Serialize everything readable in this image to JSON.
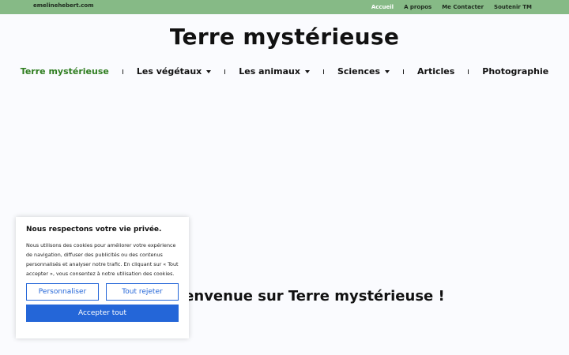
{
  "topbar": {
    "site": "emelinehebert.com",
    "links": [
      "Accueil",
      "A propos",
      "Me Contacter",
      "Soutenir TM"
    ]
  },
  "site_title": "Terre mystérieuse",
  "nav": {
    "items": [
      {
        "label": "Terre mystérieuse",
        "active": true
      },
      {
        "label": "Les végétaux",
        "dropdown": true
      },
      {
        "label": "Les animaux",
        "dropdown": true
      },
      {
        "label": "Sciences",
        "dropdown": true
      },
      {
        "label": "Articles"
      },
      {
        "label": "Photographie"
      }
    ]
  },
  "hero": {
    "title": "Bienvenue sur Terre mystérieuse !",
    "subtitle": ""
  },
  "cookie": {
    "title": "Nous respectons votre vie privée.",
    "text": "Nous utilisons des cookies pour améliorer votre expérience de navigation, diffuser des publicités ou des contenus personnalisés et analyser notre trafic. En cliquant sur « Tout accepter », vous consentez à notre utilisation des cookies.",
    "customize_label": "Personnaliser",
    "reject_label": "Tout rejeter",
    "accept_label": "Accepter tout"
  },
  "colors": {
    "topbar": "#86ba86",
    "nav_active": "#2e7d1f",
    "button_blue": "#2466d8"
  }
}
